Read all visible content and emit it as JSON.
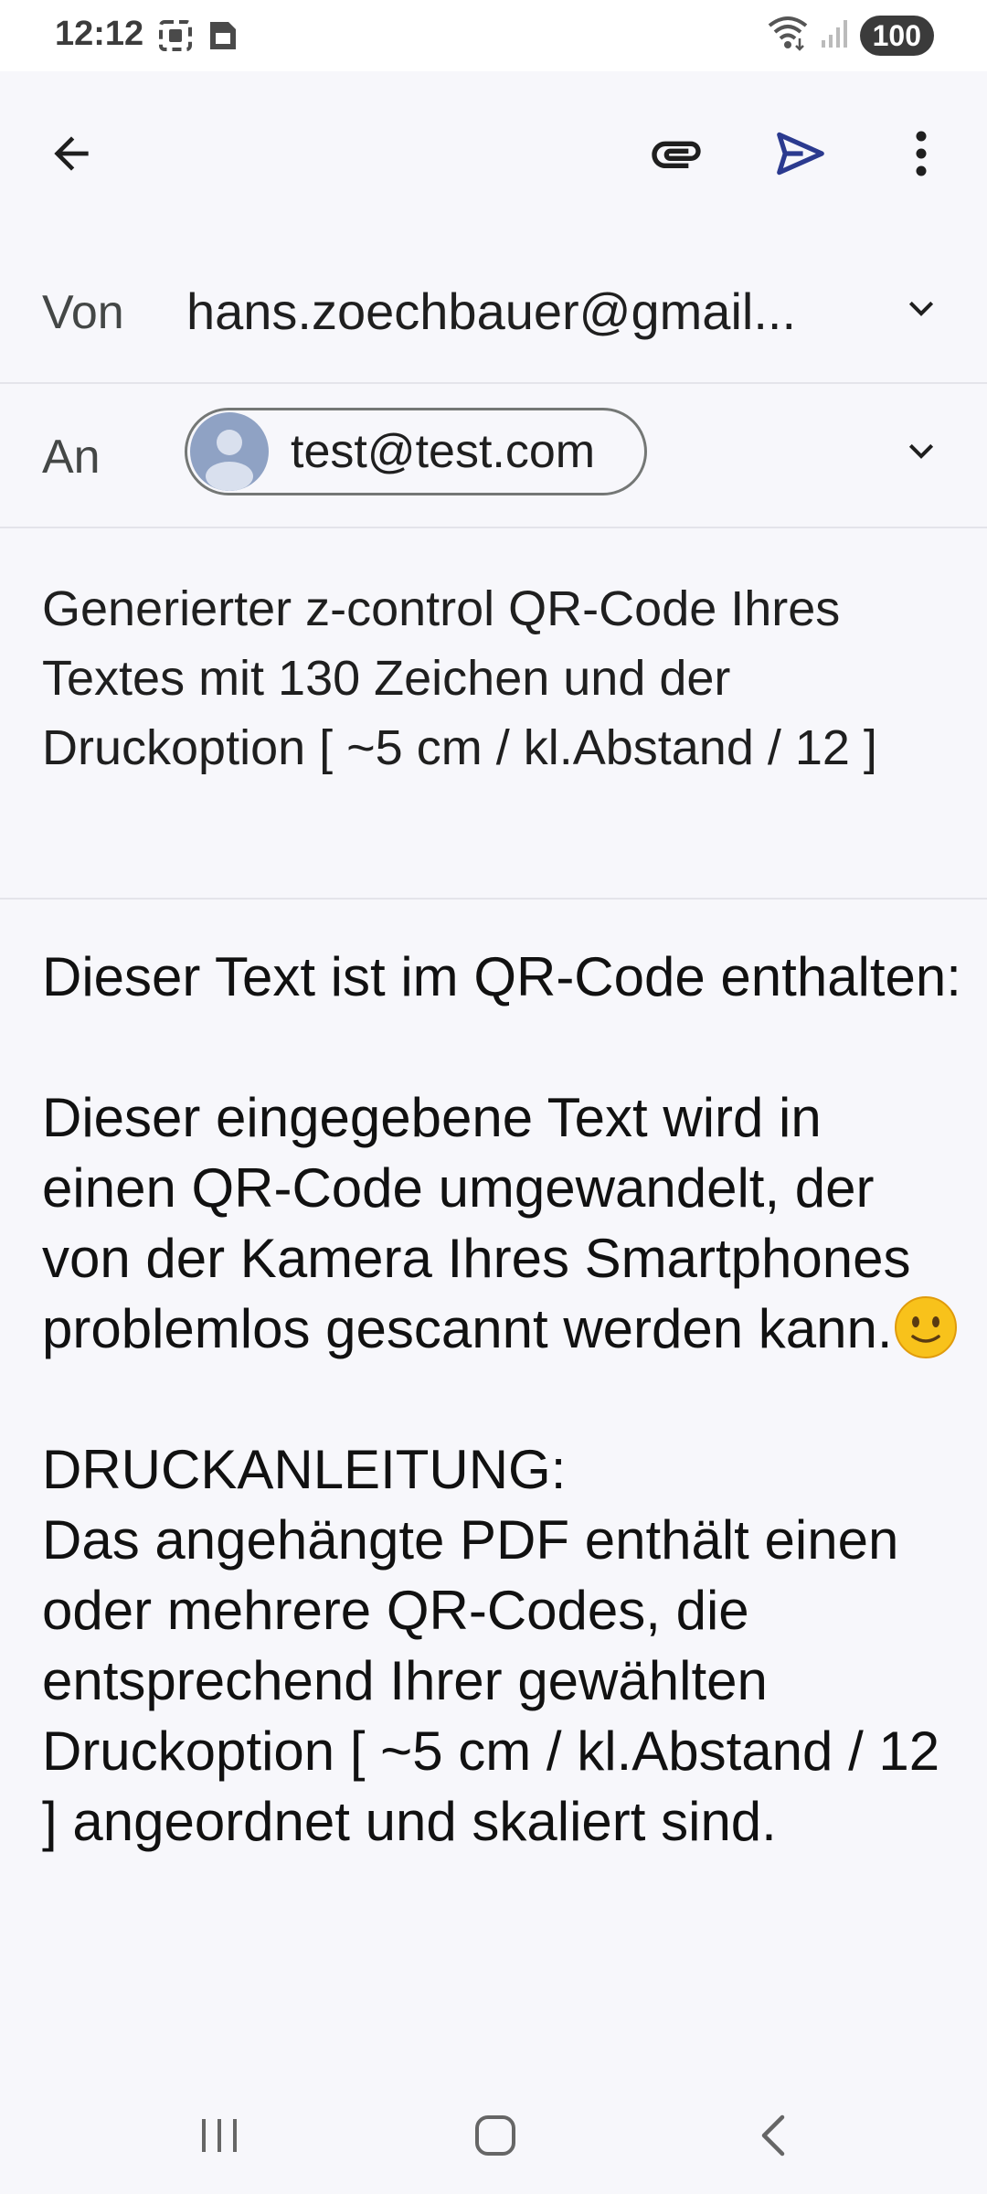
{
  "status_bar": {
    "time": "12:12",
    "battery": "100",
    "icons": [
      "screenshot-icon",
      "sim-icon",
      "wifi-icon",
      "signal-icon"
    ]
  },
  "toolbar": {
    "icons": [
      "back-arrow-icon",
      "attach-icon",
      "send-icon",
      "more-vert-icon"
    ],
    "accent_color": "#2b3a8f"
  },
  "from": {
    "label": "Von",
    "value": "hans.zoechbauer@gmail..."
  },
  "to": {
    "label": "An",
    "recipient": "test@test.com"
  },
  "subject": "Generierter z-control QR-Code Ihres Textes mit 130 Zeichen und der Druckoption  [ ~5 cm / kl.Abstand / 12 ]",
  "body": {
    "p1": "Dieser Text ist im QR-Code enthalten:",
    "p2": "Dieser eingegebene Text wird in einen QR-Code umgewandelt, der von der Kamera Ihres Smartphones problemlos gescannt werden kann.",
    "p2_emoji": "slightly-smiling-face",
    "p3_heading": "DRUCKANLEITUNG:",
    "p3": "Das angehängte PDF enthält einen oder mehrere QR-Codes, die entsprechend Ihrer gewählten Druckoption [ ~5 cm / kl.Abstand / 12 ] angeordnet und skaliert sind."
  },
  "nav_bar": {
    "icons": [
      "recents-icon",
      "home-icon",
      "back-icon"
    ]
  }
}
